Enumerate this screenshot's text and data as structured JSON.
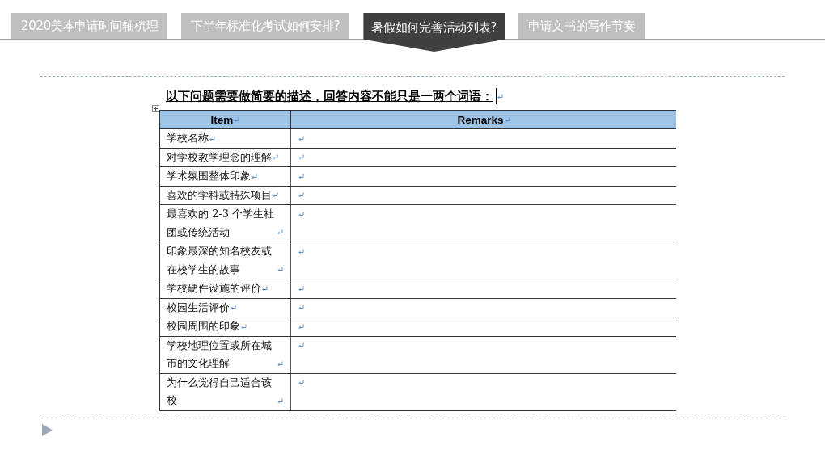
{
  "tabs": [
    {
      "label": "2020美本申请时间轴梳理",
      "selected": false
    },
    {
      "label": "下半年标准化考试如何安排?",
      "selected": false
    },
    {
      "label": "暑假如何完善活动列表?",
      "selected": true
    },
    {
      "label": "申请文书的写作节奏",
      "selected": false
    }
  ],
  "heading": "以下问题需要做简要的描述，回答内容不能只是一两个词语：",
  "table": {
    "columns": [
      "Item",
      "Remarks"
    ],
    "rows": [
      [
        "学校名称"
      ],
      [
        "对学校教学理念的理解"
      ],
      [
        "学术氛围整体印象"
      ],
      [
        "喜欢的学科或特殊项目"
      ],
      [
        "最喜欢的 2-3 个学生社团或传统活动"
      ],
      [
        "印象最深的知名校友或在校学生的故事"
      ],
      [
        "学校硬件设施的评价"
      ],
      [
        "校园生活评价"
      ],
      [
        "校园周围的印象"
      ],
      [
        "学校地理位置或所在城市的文化理解"
      ],
      [
        "为什么觉得自己适合该校"
      ]
    ]
  }
}
